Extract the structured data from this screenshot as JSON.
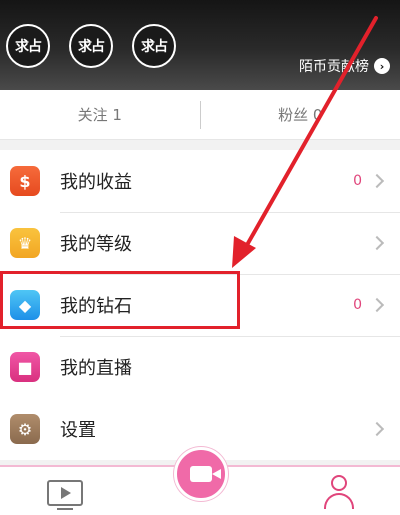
{
  "header": {
    "avatars": [
      "求占",
      "求占",
      "求占"
    ],
    "rank_label": "陌币贡献榜",
    "rank_chevron": "›"
  },
  "follow": {
    "following": "关注 1",
    "fans": "粉丝 0"
  },
  "menu": {
    "items": [
      {
        "label": "我的收益",
        "count": "0",
        "icon": "money-bag-icon",
        "glyph": "$"
      },
      {
        "label": "我的等级",
        "count": "",
        "icon": "crown-icon",
        "glyph": "♛"
      },
      {
        "label": "我的钻石",
        "count": "0",
        "icon": "diamond-icon",
        "glyph": "◆"
      },
      {
        "label": "我的直播",
        "count": "",
        "icon": "live-camera-icon",
        "glyph": "■"
      }
    ],
    "settings": {
      "label": "设置",
      "icon": "gear-icon",
      "glyph": "⚙"
    }
  },
  "annotation": {
    "color": "#e2212b"
  },
  "tabbar": {
    "accent": "#f06aa8",
    "tabs": [
      "play-icon",
      "camera-icon",
      "profile-icon"
    ]
  }
}
